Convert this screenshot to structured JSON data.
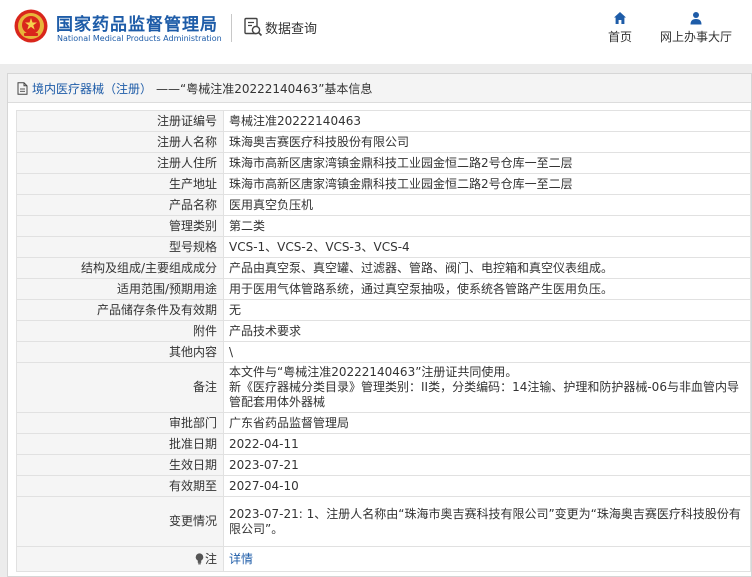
{
  "header": {
    "brand_cn": "国家药品监督管理局",
    "brand_en": "National Medical Products Administration",
    "search_label": "数据查询",
    "nav": [
      {
        "label": "首页",
        "icon": "home-icon"
      },
      {
        "label": "网上办事大厅",
        "icon": "user-icon"
      }
    ]
  },
  "panel": {
    "breadcrumb": "境内医疗器械（注册）",
    "title_rest": "——“粤械注准20222140463”基本信息"
  },
  "rows": [
    {
      "key": "注册证编号",
      "value": "粤械注准20222140463"
    },
    {
      "key": "注册人名称",
      "value": "珠海奥吉赛医疗科技股份有限公司"
    },
    {
      "key": "注册人住所",
      "value": "珠海市高新区唐家湾镇金鼎科技工业园金恒二路2号仓库一至二层"
    },
    {
      "key": "生产地址",
      "value": "珠海市高新区唐家湾镇金鼎科技工业园金恒二路2号仓库一至二层"
    },
    {
      "key": "产品名称",
      "value": "医用真空负压机"
    },
    {
      "key": "管理类别",
      "value": "第二类"
    },
    {
      "key": "型号规格",
      "value": "VCS-1、VCS-2、VCS-3、VCS-4"
    },
    {
      "key": "结构及组成/主要组成成分",
      "value": "产品由真空泵、真空罐、过滤器、管路、阀门、电控箱和真空仪表组成。"
    },
    {
      "key": "适用范围/预期用途",
      "value": "用于医用气体管路系统，通过真空泵抽吸，使系统各管路产生医用负压。"
    },
    {
      "key": "产品储存条件及有效期",
      "value": "无"
    },
    {
      "key": "附件",
      "value": "产品技术要求"
    },
    {
      "key": "其他内容",
      "value": "\\"
    },
    {
      "key": "备注",
      "value": "本文件与“粤械注准20222140463”注册证共同使用。\n新《医疗器械分类目录》管理类别：II类，分类编码：14注输、护理和防护器械-06与非血管内导管配套用体外器械"
    },
    {
      "key": "审批部门",
      "value": "广东省药品监督管理局"
    },
    {
      "key": "批准日期",
      "value": "2022-04-11"
    },
    {
      "key": "生效日期",
      "value": "2023-07-21"
    },
    {
      "key": "有效期至",
      "value": "2027-04-10"
    },
    {
      "key": "变更情况",
      "value": "2023-07-21: 1、注册人名称由“珠海市奥吉赛科技有限公司”变更为“珠海奥吉赛医疗科技股份有限公司”。"
    },
    {
      "key": "注",
      "value": "详情"
    }
  ],
  "colors": {
    "brand_blue": "#1e5ca8",
    "band_gray": "#ececec",
    "key_bg": "#f5f5f5"
  }
}
